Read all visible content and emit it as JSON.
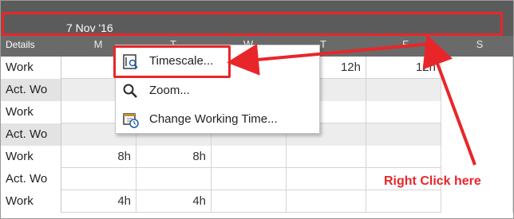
{
  "timescale": {
    "top_tier_label": "7 Nov '16",
    "details_label": "Details",
    "days": [
      "M",
      "T",
      "W",
      "T",
      "F",
      "S"
    ]
  },
  "rows": [
    {
      "label": "Work",
      "cells": [
        "1",
        "",
        "",
        "12h",
        "12h",
        ""
      ],
      "shaded": false
    },
    {
      "label": "Act. Wo",
      "cells": [
        "",
        "",
        "",
        "",
        "",
        ""
      ],
      "shaded": true
    },
    {
      "label": "Work",
      "cells": [
        "1",
        "",
        "",
        "",
        "",
        ""
      ],
      "shaded": false
    },
    {
      "label": "Act. Wo",
      "cells": [
        "",
        "",
        "",
        "",
        "",
        ""
      ],
      "shaded": true
    },
    {
      "label": "Work",
      "cells": [
        "8h",
        "8h",
        "",
        "",
        "",
        ""
      ],
      "shaded": false
    },
    {
      "label": "Act. Wo",
      "cells": [
        "",
        "",
        "",
        "",
        "",
        ""
      ],
      "shaded": false
    },
    {
      "label": "Work",
      "cells": [
        "4h",
        "4h",
        "",
        "",
        "",
        ""
      ],
      "shaded": false
    }
  ],
  "context_menu": {
    "items": [
      {
        "label": "Timescale...",
        "icon": "timescale-icon"
      },
      {
        "label": "Zoom...",
        "icon": "magnifier-icon"
      },
      {
        "label": "Change Working Time...",
        "icon": "calendar-clock-icon"
      }
    ]
  },
  "annotation": {
    "text": "Right Click here"
  },
  "colors": {
    "highlight": "#e8262a",
    "header_dark": "#5b5b5b",
    "header_mid": "#6a6a6a"
  }
}
